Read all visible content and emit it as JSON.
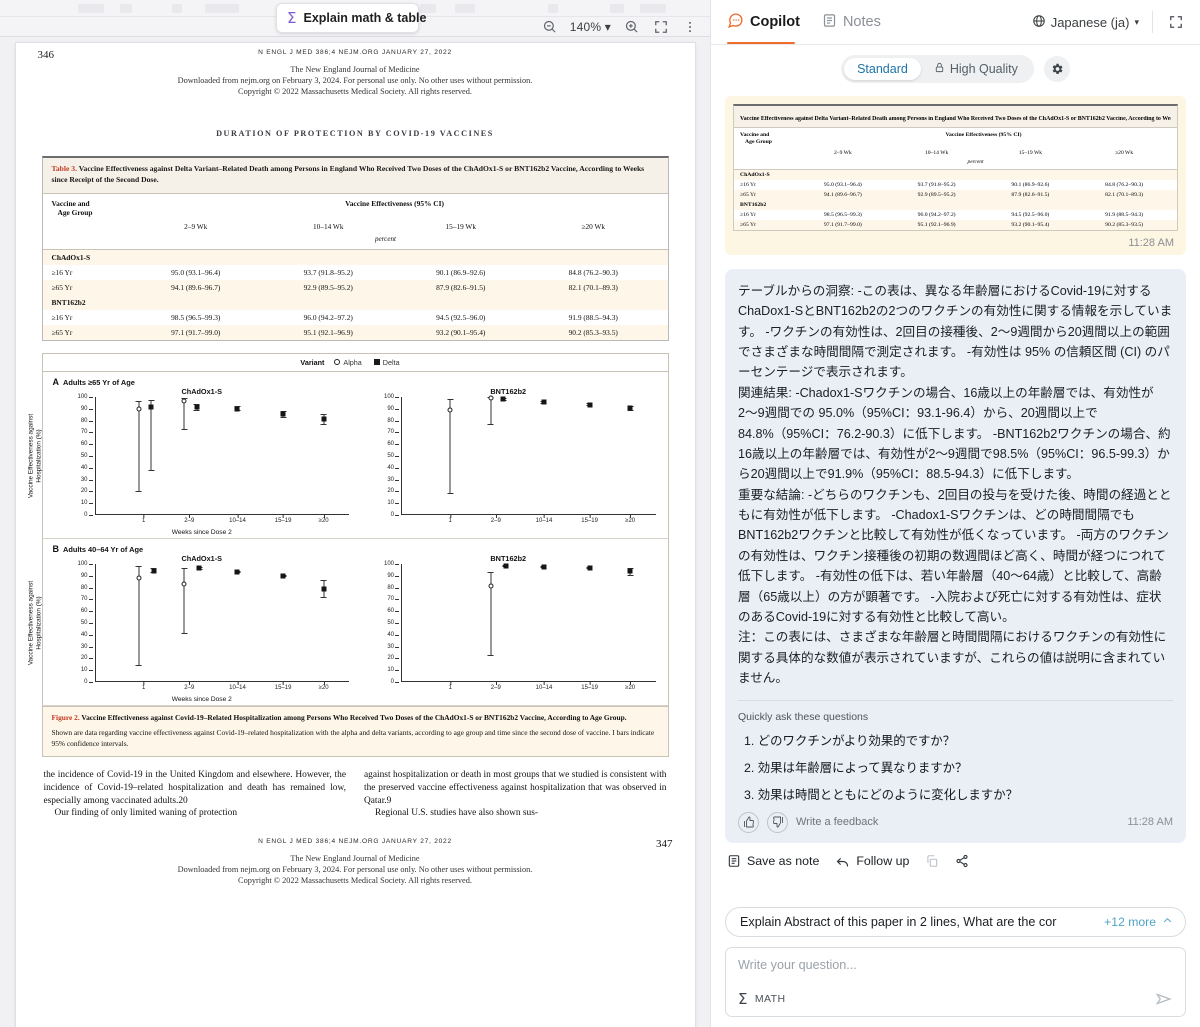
{
  "viewer": {
    "toolbar": {
      "explain_chip": "Explain math & table",
      "sigma": "Σ",
      "zoom_out_icon": "zoom-out-icon",
      "zoom_level": "140% ▾",
      "zoom_in_icon": "zoom-in-icon",
      "fullscreen_icon": "fullscreen-icon",
      "more_icon": "more-vertical-icon"
    },
    "page": {
      "page_number_top": "346",
      "page_number_bottom": "347",
      "running_head": "N ENGL J MED 386;4   NEJM.ORG   JANUARY 27, 2022",
      "download_line1": "The New England Journal of Medicine",
      "download_line2": "Downloaded from nejm.org on February 3, 2024. For personal use only. No other uses without permission.",
      "download_line3": "Copyright © 2022 Massachusetts Medical Society. All rights reserved.",
      "article_title": "DURATION OF PROTECTION BY COVID-19 VACCINES"
    },
    "table3": {
      "label": "Table 3.",
      "caption": " Vaccine Effectiveness against Delta Variant–Related Death among Persons in England Who Received Two Doses of the ChAdOx1-S or BNT162b2 Vaccine, According to Weeks since Receipt of the Second Dose.",
      "col_group": "Vaccine and\nAge Group",
      "col_group_l1": "Vaccine and",
      "col_group_l2": "Age Group",
      "spanner": "Vaccine Effectiveness (95% CI)",
      "units": "percent",
      "columns": [
        "2–9 Wk",
        "10–14 Wk",
        "15–19 Wk",
        "≥20 Wk"
      ],
      "sections": [
        {
          "name": "ChAdOx1-S",
          "rows": [
            {
              "label": "≥16 Yr",
              "values": [
                "95.0 (93.1–96.4)",
                "93.7 (91.8–95.2)",
                "90.1 (86.9–92.6)",
                "84.8 (76.2–90.3)"
              ]
            },
            {
              "label": "≥65 Yr",
              "values": [
                "94.1 (89.6–96.7)",
                "92.9 (89.5–95.2)",
                "87.9 (82.6–91.5)",
                "82.1 (70.1–89.3)"
              ]
            }
          ]
        },
        {
          "name": "BNT162b2",
          "rows": [
            {
              "label": "≥16 Yr",
              "values": [
                "98.5 (96.5–99.3)",
                "96.0 (94.2–97.2)",
                "94.5 (92.5–96.0)",
                "91.9 (88.5–94.3)"
              ]
            },
            {
              "label": "≥65 Yr",
              "values": [
                "97.1 (91.7–99.0)",
                "95.1 (92.1–96.9)",
                "93.2 (90.1–95.4)",
                "90.2 (85.3–93.5)"
              ]
            }
          ]
        }
      ]
    },
    "figure2": {
      "legend_title": "Variant",
      "legend_items": [
        "Alpha",
        "Delta"
      ],
      "panelA_letter": "A",
      "panelA_title": "Adults ≥65 Yr of Age",
      "panelB_letter": "B",
      "panelB_title": "Adults 40–64 Yr of Age",
      "chart_titles": [
        "ChAdOx1-S",
        "BNT162b2"
      ],
      "yaxis_title_l1": "Vaccine Effectiveness against",
      "yaxis_title_l2": "Hospitalization (%)",
      "xaxis_title": "Weeks since Dose 2",
      "yticks": [
        "0",
        "10",
        "20",
        "30",
        "40",
        "50",
        "60",
        "70",
        "80",
        "90",
        "100"
      ],
      "xticks": [
        "1",
        "2–9",
        "10–14",
        "15–19",
        "≥20"
      ],
      "cap_label": "Figure 2.",
      "cap_title": " Vaccine Effectiveness against Covid-19–Related Hospitalization among Persons Who Received Two Doses of the ChAdOx1-S or BNT162b2 Vaccine, According to Age Group.",
      "cap_body": "Shown are data regarding vaccine effectiveness against Covid-19–related hospitalization with the alpha and delta variants, according to age group and time since the second dose of vaccine. I bars indicate 95% confidence intervals."
    },
    "body": {
      "col1_p1": "the incidence of Covid-19 in the United Kingdom and elsewhere. However, the incidence of Covid-19–related hospitalization and death has remained low, especially among vaccinated adults.20",
      "col1_p2": "Our finding of only limited waning of protection",
      "col2_p1": "against hospitalization or death in most groups that we studied is consistent with the preserved vaccine effectiveness against hospitalization that was observed in Qatar.9",
      "col2_p2": "Regional U.S. studies have also shown sus-"
    }
  },
  "chart_data": [
    {
      "type": "scatter",
      "title": "ChAdOx1-S",
      "panel": "A  Adults ≥65 Yr of Age",
      "xlabel": "Weeks since Dose 2",
      "ylabel": "Vaccine Effectiveness against Hospitalization (%)",
      "ylim": [
        0,
        100
      ],
      "categories": [
        "1",
        "2–9",
        "10–14",
        "15–19",
        "≥20"
      ],
      "series": [
        {
          "name": "Alpha",
          "values": [
            89.5,
            96.5,
            null,
            null,
            null
          ],
          "ci_low": [
            19.0,
            72.0,
            null,
            null,
            null
          ],
          "ci_high": [
            97.0,
            99.5,
            null,
            null,
            null
          ]
        },
        {
          "name": "Delta",
          "values": [
            91.5,
            91.5,
            90.0,
            85.5,
            81.5
          ],
          "ci_low": [
            37.0,
            88.0,
            88.0,
            82.0,
            76.0
          ],
          "ci_high": [
            97.5,
            94.0,
            92.0,
            88.0,
            86.0
          ]
        }
      ]
    },
    {
      "type": "scatter",
      "title": "BNT162b2",
      "panel": "A  Adults ≥65 Yr of Age",
      "xlabel": "Weeks since Dose 2",
      "ylabel": "Vaccine Effectiveness against Hospitalization (%)",
      "ylim": [
        0,
        100
      ],
      "categories": [
        "1",
        "2–9",
        "10–14",
        "15–19",
        "≥20"
      ],
      "series": [
        {
          "name": "Alpha",
          "values": [
            89.0,
            99.5,
            null,
            null,
            null
          ],
          "ci_low": [
            17.0,
            76.0,
            null,
            null,
            null
          ],
          "ci_high": [
            98.0,
            100.0,
            null,
            null,
            null
          ]
        },
        {
          "name": "Delta",
          "values": [
            null,
            98.0,
            96.0,
            93.5,
            90.5
          ],
          "ci_low": [
            null,
            96.5,
            94.5,
            92.0,
            88.5
          ],
          "ci_high": [
            null,
            99.0,
            97.0,
            95.0,
            92.5
          ]
        }
      ]
    },
    {
      "type": "scatter",
      "title": "ChAdOx1-S",
      "panel": "B  Adults 40–64 Yr of Age",
      "xlabel": "Weeks since Dose 2",
      "ylabel": "Vaccine Effectiveness against Hospitalization (%)",
      "ylim": [
        0,
        100
      ],
      "categories": [
        "1",
        "2–9",
        "10–14",
        "15–19",
        "≥20"
      ],
      "series": [
        {
          "name": "Alpha",
          "values": [
            88.0,
            83.0,
            null,
            null,
            null
          ],
          "ci_low": [
            12.5,
            40.5,
            null,
            null,
            null
          ],
          "ci_high": [
            98.5,
            96.5,
            null,
            null,
            null
          ]
        },
        {
          "name": "Delta",
          "values": [
            94.5,
            96.5,
            93.5,
            90.0,
            79.0
          ],
          "ci_low": [
            92.0,
            95.0,
            92.5,
            89.0,
            71.0
          ],
          "ci_high": [
            97.0,
            97.5,
            94.5,
            91.0,
            86.0
          ]
        }
      ]
    },
    {
      "type": "scatter",
      "title": "BNT162b2",
      "panel": "B  Adults 40–64 Yr of Age",
      "xlabel": "Weeks since Dose 2",
      "ylabel": "Vaccine Effectiveness against Hospitalization (%)",
      "ylim": [
        0,
        100
      ],
      "categories": [
        "1",
        "2–9",
        "10–14",
        "15–19",
        "≥20"
      ],
      "series": [
        {
          "name": "Alpha",
          "values": [
            null,
            81.5,
            null,
            null,
            null
          ],
          "ci_low": [
            null,
            21.5,
            null,
            null,
            null
          ],
          "ci_high": [
            null,
            93.0,
            null,
            null,
            null
          ]
        },
        {
          "name": "Delta",
          "values": [
            null,
            98.5,
            97.5,
            96.5,
            94.0
          ],
          "ci_low": [
            null,
            97.5,
            96.5,
            95.5,
            90.0
          ],
          "ci_high": [
            null,
            99.0,
            98.5,
            97.5,
            97.0
          ]
        }
      ]
    }
  ],
  "copilot": {
    "tabs": [
      {
        "label": "Copilot",
        "icon": "copilot-chat-icon",
        "active": true
      },
      {
        "label": "Notes",
        "icon": "notes-icon",
        "active": false
      }
    ],
    "language": "Japanese (ja)",
    "language_caret": "▾",
    "globe_icon": "globe-icon",
    "expand_icon": "expand-icon",
    "modes": [
      {
        "label": "Standard",
        "selected": true
      },
      {
        "label": "High Quality",
        "selected": false,
        "icon": "lock-icon"
      }
    ],
    "settings_icon": "gear-icon",
    "message_time": "11:28 AM",
    "answer": {
      "paragraphs": [
        "テーブルからの洞察: -この表は、異なる年齢層におけるCovid-19に対するChaDox1-SとBNT162b2の2つのワクチンの有効性に関する情報を示しています。 -ワクチンの有効性は、2回目の接種後、2〜9週間から20週間以上の範囲でさまざまな時間間隔で測定されます。 -有効性は 95% の信頼区間 (CI) のパーセンテージで表示されます。",
        "関連結果: -Chadox1-Sワクチンの場合、16歳以上の年齢層では、有効性が2〜9週間での 95.0%（95%CI：93.1-96.4）から、20週間以上で 84.8%（95%CI：76.2-90.3）に低下します。 -BNT162b2ワクチンの場合、約16歳以上の年齢層では、有効性が2〜9週間で98.5%（95%CI：96.5-99.3）から20週間以上で91.9%（95%CI：88.5-94.3）に低下します。",
        "重要な結論: -どちらのワクチンも、2回目の投与を受けた後、時間の経過とともに有効性が低下します。 -Chadox1-Sワクチンは、どの時間間隔でもBNT162b2ワクチンと比較して有効性が低くなっています。 -両方のワクチンの有効性は、ワクチン接種後の初期の数週間ほど高く、時間が経つにつれて低下します。 -有効性の低下は、若い年齢層（40〜64歳）と比較して、高齢層（65歳以上）の方が顕著です。 -入院および死亡に対する有効性は、症状のあるCovid-19に対する有効性と比較して高い。",
        "注：この表には、さまざまな年齢層と時間間隔におけるワクチンの有効性に関する具体的な数値が表示されていますが、これらの値は説明に含まれていません。"
      ]
    },
    "quick_questions_header": "Quickly ask these questions",
    "quick_questions": [
      "1. どのワクチンがより効果的ですか？",
      "2. 効果は年齢層によって異なりますか？",
      "3. 効果は時間とともにどのように変化しますか？"
    ],
    "feedback": {
      "thumbs_up_icon": "thumbs-up-icon",
      "thumbs_down_icon": "thumbs-down-icon",
      "label": "Write a feedback",
      "time": "11:28 AM"
    },
    "actions": [
      {
        "label": "Save as note",
        "icon": "note-icon"
      },
      {
        "label": "Follow up",
        "icon": "reply-arrow-icon"
      },
      {
        "label": "",
        "icon": "copy-icon"
      },
      {
        "label": "",
        "icon": "share-icon"
      }
    ],
    "prompt_chip": {
      "text": "Explain Abstract of this paper in 2 lines, What are the cor",
      "more": "+12 more",
      "caret": "∧"
    },
    "composer": {
      "placeholder": "Write your question...",
      "math_label": "MATH",
      "math_sigma": "Σ",
      "send_icon": "send-icon"
    }
  },
  "colors": {
    "accent_orange": "#ef6c2e",
    "link_blue": "#4ea3c8",
    "mode_active": "#1e74a8",
    "answer_bg": "#e9eff5",
    "thumb_bg": "#fdf6e2",
    "nejm_red": "#c23b22"
  }
}
